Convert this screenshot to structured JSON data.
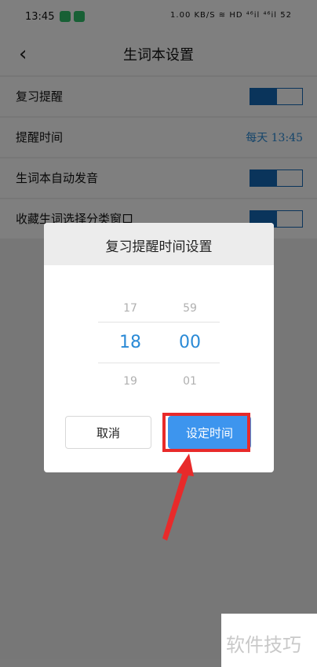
{
  "status_bar": {
    "time": "13:45",
    "right": "1.00 KB/S  ≋ HD  ⁴⁶il ⁴⁶il  52"
  },
  "header": {
    "back_icon": "chevron-left-icon",
    "title": "生词本设置"
  },
  "settings": [
    {
      "label": "复习提醒",
      "control": "toggle",
      "on": true
    },
    {
      "label": "提醒时间",
      "control": "value",
      "value": "每天 13:45"
    },
    {
      "label": "生词本自动发音",
      "control": "toggle",
      "on": true
    },
    {
      "label": "收藏生词选择分类窗口",
      "control": "toggle",
      "on": true
    }
  ],
  "dialog": {
    "title": "复习提醒时间设置",
    "hours": {
      "prev": "17",
      "selected": "18",
      "next": "19"
    },
    "minutes": {
      "prev": "59",
      "selected": "00",
      "next": "01"
    },
    "cancel_label": "取消",
    "confirm_label": "设定时间"
  },
  "annotation": {
    "highlight_color": "#e82a2a",
    "target": "设定时间"
  },
  "watermark": "软件技巧",
  "colors": {
    "accent": "#3d95ee",
    "toggle": "#1568b7",
    "value_text": "#2a8ad6"
  }
}
